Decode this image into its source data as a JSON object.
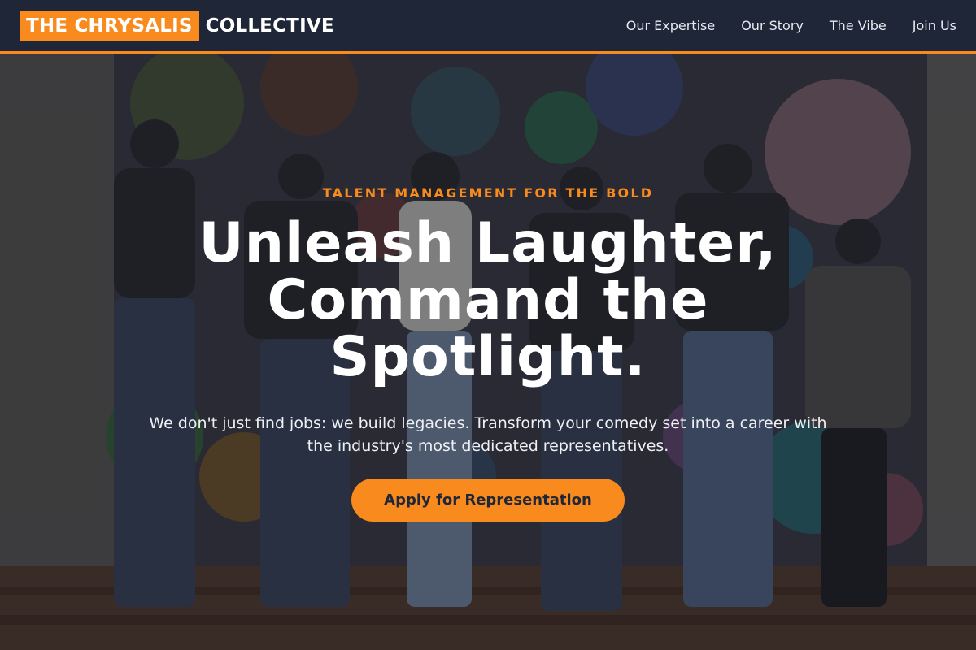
{
  "brand": {
    "highlight": "THE CHRYSALIS",
    "rest": "COLLECTIVE"
  },
  "nav": {
    "items": [
      {
        "label": "Our Expertise"
      },
      {
        "label": "Our Story"
      },
      {
        "label": "The Vibe"
      },
      {
        "label": "Join Us"
      }
    ]
  },
  "hero": {
    "eyebrow": "TALENT MANAGEMENT FOR THE BOLD",
    "headline": "Unleash Laughter, Command the Spotlight.",
    "subtext": "We don't just find jobs: we build legacies. Transform your comedy set into a career with the industry's most dedicated representatives.",
    "cta": "Apply for Representation",
    "background_image": "group-photo-mural"
  },
  "colors": {
    "accent": "#f98a1d",
    "navbar": "#1e2638",
    "text_light": "#ffffff"
  }
}
